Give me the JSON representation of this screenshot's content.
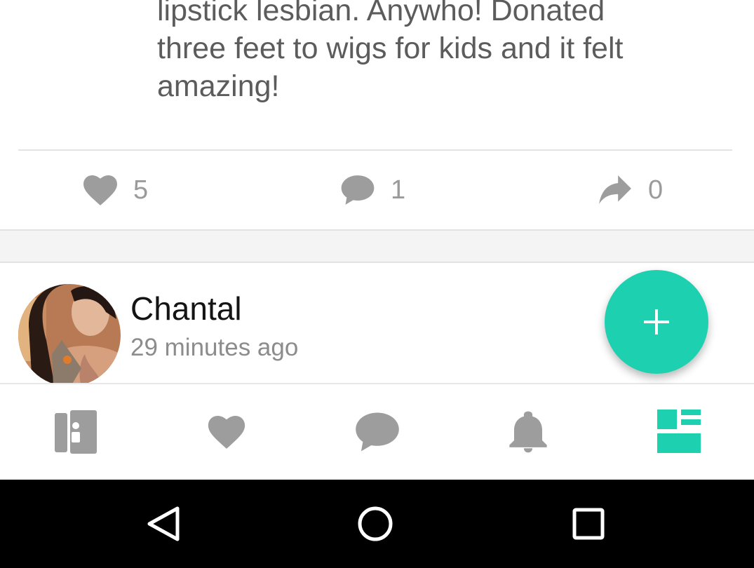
{
  "post": {
    "text": "lipstick lesbian. Anywho! Donated\nthree feet to wigs for kids and it felt\namazing!",
    "likes": "5",
    "comments": "1",
    "shares": "0"
  },
  "next_post": {
    "author": "Chantal",
    "time": "29 minutes ago"
  },
  "fab": {
    "icon": "plus-icon"
  },
  "bottom_nav": {
    "items": [
      {
        "icon": "profile-card-icon",
        "active": false
      },
      {
        "icon": "heart-icon",
        "active": false
      },
      {
        "icon": "chat-bubble-icon",
        "active": false
      },
      {
        "icon": "bell-icon",
        "active": false
      },
      {
        "icon": "feed-layout-icon",
        "active": true
      }
    ]
  },
  "system_nav": [
    "back-icon",
    "home-icon",
    "recents-icon"
  ],
  "colors": {
    "accent": "#1dd1b0",
    "icon_grey": "#9d9d9d",
    "text": "#5c5c5c"
  }
}
